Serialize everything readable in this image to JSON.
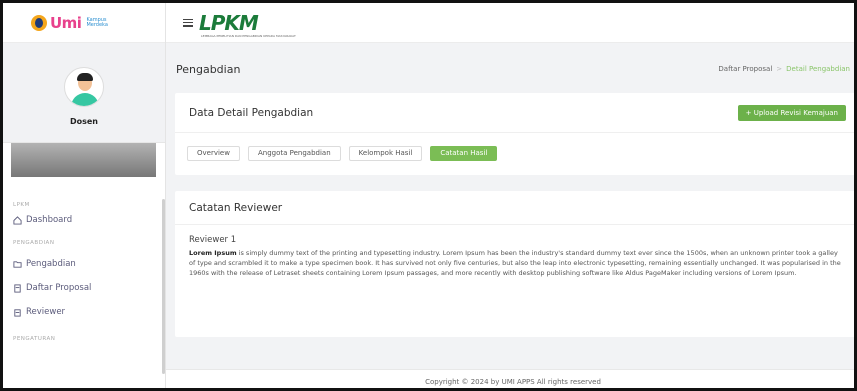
{
  "sidebar": {
    "brand": {
      "name": "Umi",
      "sub_line1": "Kampus",
      "sub_line2": "Merdeka"
    },
    "profile": {
      "name": "Dosen"
    },
    "sections": [
      {
        "label": "LPKM",
        "items": [
          {
            "label": "Dashboard",
            "icon": "home-icon"
          }
        ]
      },
      {
        "label": "PENGABDIAN",
        "items": [
          {
            "label": "Pengabdian",
            "icon": "folder-icon"
          },
          {
            "label": "Daftar Proposal",
            "icon": "document-icon"
          },
          {
            "label": "Reviewer",
            "icon": "clipboard-icon"
          }
        ]
      },
      {
        "label": "PENGATURAN",
        "items": []
      }
    ]
  },
  "header": {
    "logo": "LPKM",
    "logo_sub": "LEMBAGA PENELITIAN DAN PENGABDIAN KEPADA MASYARAKAT"
  },
  "page": {
    "title": "Pengabdian",
    "breadcrumb": {
      "parent": "Daftar Proposal",
      "separator": ">",
      "current": "Detail Pengabdian"
    }
  },
  "detail_card": {
    "title": "Data Detail Pengabdian",
    "upload_button": "+  Upload Revisi Kemajuan",
    "tabs": [
      "Overview",
      "Anggota Pengabdian",
      "Kelompok Hasil",
      "Catatan Hasil"
    ],
    "active_tab": "Catatan Hasil"
  },
  "review_card": {
    "title": "Catatan Reviewer",
    "reviewer": "Reviewer 1",
    "text_bold": "Lorem Ipsum",
    "text": " is simply dummy text of the printing and typesetting industry. Lorem Ipsum has been the industry's standard dummy text ever since the 1500s, when an unknown printer took a galley of type and scrambled it to make a type specimen book. It has survived not only five centuries, but also the leap into electronic typesetting, remaining essentially unchanged. It was popularised in the 1960s with the release of Letraset sheets containing Lorem Ipsum passages, and more recently with desktop publishing software like Aldus PageMaker including versions of Lorem Ipsum."
  },
  "footer": {
    "text": "Copyright © 2024 by UMI APPS All rights reserved"
  },
  "colors": {
    "accent": "#7bbd55",
    "brand_green": "#1b7b3a",
    "brand_pink": "#e8418c"
  }
}
